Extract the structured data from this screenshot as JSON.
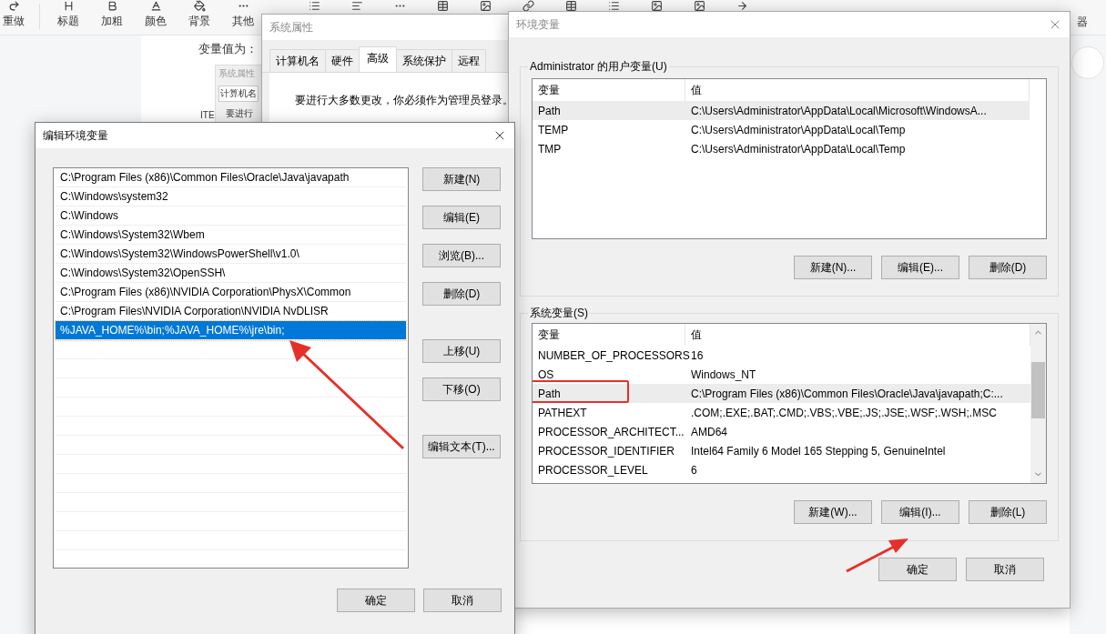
{
  "editor_toolbar": {
    "buttons": [
      "重做",
      "标题",
      "加粗",
      "颜色",
      "背景",
      "其他"
    ],
    "trailing_label": "器"
  },
  "document": {
    "heading": "变量值为：",
    "side_text": "ITE",
    "embedded_screenshot": {
      "title": "系统属性",
      "tab": "计算机名",
      "text": "要进行"
    }
  },
  "system_properties": {
    "title": "系统属性",
    "active": false,
    "tabs": [
      {
        "label": "计算机名",
        "selected": false
      },
      {
        "label": "硬件",
        "selected": false
      },
      {
        "label": "高级",
        "selected": true
      },
      {
        "label": "系统保护",
        "selected": false
      },
      {
        "label": "远程",
        "selected": false
      }
    ],
    "notice": "要进行大多数更改，你必须作为管理员登录。"
  },
  "environment_variables": {
    "title": "环境变量",
    "active": false,
    "user_group": {
      "label": "Administrator 的用户变量(U)",
      "columns": [
        "变量",
        "值"
      ],
      "rows": [
        {
          "variable": "Path",
          "value": "C:\\Users\\Administrator\\AppData\\Local\\Microsoft\\WindowsA...",
          "selected": true
        },
        {
          "variable": "TEMP",
          "value": "C:\\Users\\Administrator\\AppData\\Local\\Temp",
          "selected": false
        },
        {
          "variable": "TMP",
          "value": "C:\\Users\\Administrator\\AppData\\Local\\Temp",
          "selected": false
        }
      ],
      "buttons": [
        "新建(N)...",
        "编辑(E)...",
        "删除(D)"
      ]
    },
    "system_group": {
      "label": "系统变量(S)",
      "columns": [
        "变量",
        "值"
      ],
      "rows": [
        {
          "variable": "NUMBER_OF_PROCESSORS",
          "value": "16",
          "selected": false,
          "annotated": false
        },
        {
          "variable": "OS",
          "value": "Windows_NT",
          "selected": false,
          "annotated": false
        },
        {
          "variable": "Path",
          "value": "C:\\Program Files (x86)\\Common Files\\Oracle\\Java\\javapath;C:...",
          "selected": true,
          "annotated": true
        },
        {
          "variable": "PATHEXT",
          "value": ".COM;.EXE;.BAT;.CMD;.VBS;.VBE;.JS;.JSE;.WSF;.WSH;.MSC",
          "selected": false,
          "annotated": false
        },
        {
          "variable": "PROCESSOR_ARCHITECT...",
          "value": "AMD64",
          "selected": false,
          "annotated": false
        },
        {
          "variable": "PROCESSOR_IDENTIFIER",
          "value": "Intel64 Family 6 Model 165 Stepping 5, GenuineIntel",
          "selected": false,
          "annotated": false
        },
        {
          "variable": "PROCESSOR_LEVEL",
          "value": "6",
          "selected": false,
          "annotated": false
        }
      ],
      "buttons": [
        "新建(W)...",
        "编辑(I)...",
        "删除(L)"
      ]
    },
    "buttons": [
      "确定",
      "取消"
    ]
  },
  "edit_dialog": {
    "title": "编辑环境变量",
    "active": true,
    "items": [
      {
        "text": "C:\\Program Files (x86)\\Common Files\\Oracle\\Java\\javapath",
        "selected": false
      },
      {
        "text": "C:\\Windows\\system32",
        "selected": false
      },
      {
        "text": "C:\\Windows",
        "selected": false
      },
      {
        "text": "C:\\Windows\\System32\\Wbem",
        "selected": false
      },
      {
        "text": "C:\\Windows\\System32\\WindowsPowerShell\\v1.0\\",
        "selected": false
      },
      {
        "text": "C:\\Windows\\System32\\OpenSSH\\",
        "selected": false
      },
      {
        "text": "C:\\Program Files (x86)\\NVIDIA Corporation\\PhysX\\Common",
        "selected": false
      },
      {
        "text": "C:\\Program Files\\NVIDIA Corporation\\NVIDIA NvDLISR",
        "selected": false
      },
      {
        "text": "%JAVA_HOME%\\bin;%JAVA_HOME%\\jre\\bin;",
        "selected": true
      }
    ],
    "side_buttons": [
      "新建(N)",
      "编辑(E)",
      "浏览(B)...",
      "删除(D)",
      "上移(U)",
      "下移(O)",
      "编辑文本(T)..."
    ],
    "buttons": [
      "确定",
      "取消"
    ]
  }
}
